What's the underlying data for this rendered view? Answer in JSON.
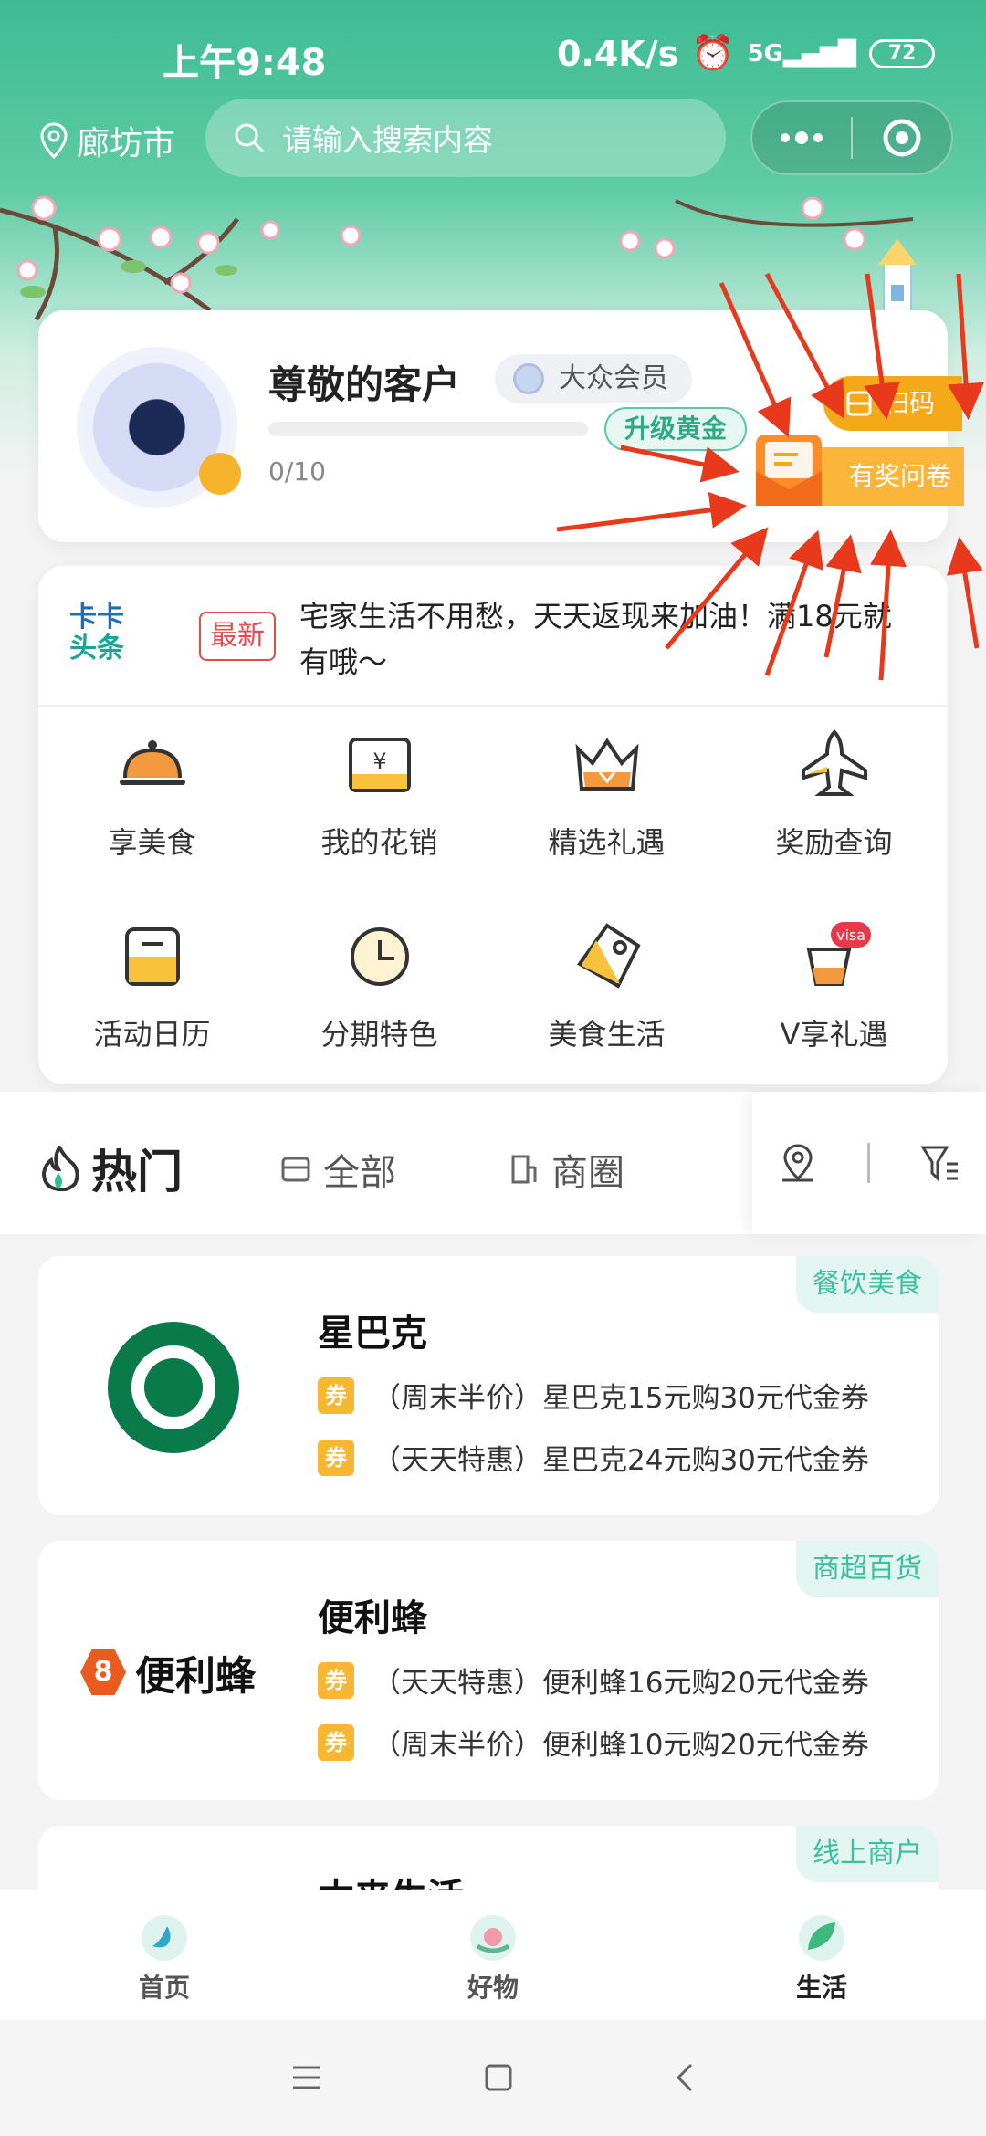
{
  "status_bar": {
    "time": "上午9:48",
    "speed": "0.4K/s",
    "battery": "72"
  },
  "topbar": {
    "city": "廊坊市",
    "search_placeholder": "请输入搜索内容"
  },
  "profile": {
    "name": "尊敬的客户",
    "member_level": "大众会员",
    "progress": "0/10",
    "progress_fraction": 0,
    "upgrade_label": "升级黄金",
    "scan_label": "扫码",
    "survey_label": "有奖问卷"
  },
  "news": {
    "brand_line1": "卡卡",
    "brand_line2": "头条",
    "tag": "最新",
    "text": "宅家生活不用愁，天天返现来加油！满18元就有哦～"
  },
  "services": [
    {
      "label": "享美食",
      "icon": "food-dish-icon"
    },
    {
      "label": "我的花销",
      "icon": "wallet-icon"
    },
    {
      "label": "精选礼遇",
      "icon": "crown-icon"
    },
    {
      "label": "奖励查询",
      "icon": "airplane-icon"
    },
    {
      "label": "活动日历",
      "icon": "calendar-icon"
    },
    {
      "label": "分期特色",
      "icon": "clock-icon"
    },
    {
      "label": "美食生活",
      "icon": "tag-icon"
    },
    {
      "label": "V享礼遇",
      "icon": "visa-drink-icon",
      "badge": "visa"
    }
  ],
  "tabs": [
    {
      "label": "热门",
      "active": true
    },
    {
      "label": "全部"
    },
    {
      "label": "商圈"
    }
  ],
  "stores": [
    {
      "name": "星巴克",
      "category": "餐饮美食",
      "deals": [
        {
          "tag": "券",
          "text": "（周末半价）星巴克15元购30元代金券"
        },
        {
          "tag": "券",
          "text": "（天天特惠）星巴克24元购30元代金券"
        }
      ]
    },
    {
      "name": "便利蜂",
      "category": "商超百货",
      "logo_text": "便利蜂",
      "deals": [
        {
          "tag": "券",
          "text": "（天天特惠）便利蜂16元购20元代金券"
        },
        {
          "tag": "券",
          "text": "（周末半价）便利蜂10元购20元代金券"
        }
      ]
    },
    {
      "name": "本来生活",
      "category": "线上商户",
      "deals": []
    }
  ],
  "bottom_nav": [
    {
      "label": "首页"
    },
    {
      "label": "好物"
    },
    {
      "label": "生活",
      "active": true
    }
  ],
  "colors": {
    "brand_green": "#3dbb92",
    "accent_orange": "#f5a819",
    "arrow_red": "#e8391c"
  }
}
